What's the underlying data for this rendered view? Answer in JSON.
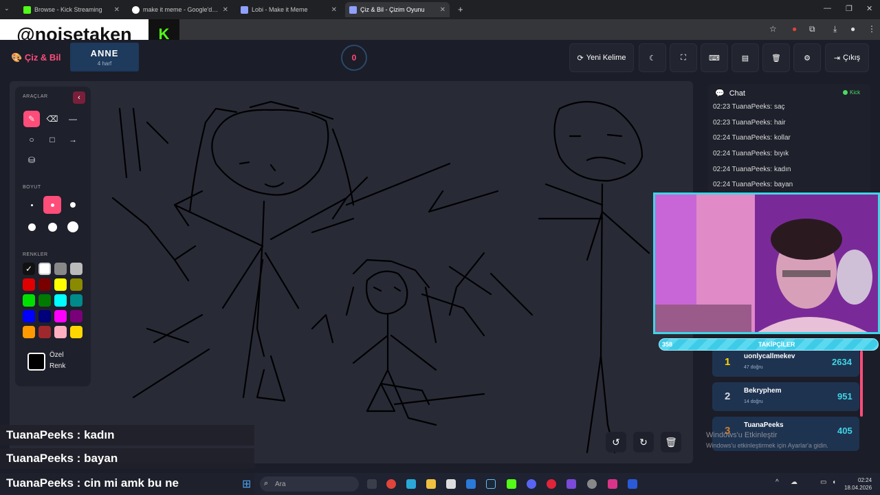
{
  "browser": {
    "tabs": [
      {
        "label": "Browse - Kick Streaming",
        "favicon_color": "#53fc18"
      },
      {
        "label": "make it meme - Google'da Ara",
        "favicon_color": "#ffffff"
      },
      {
        "label": "Lobi - Make it Meme",
        "favicon_color": "#8fa0ff"
      },
      {
        "label": "Çiz & Bil - Çizim Oyunu",
        "favicon_color": "#8fa0ff"
      }
    ]
  },
  "overlay": {
    "handle": "@noisetaken",
    "kick_logo": "K",
    "chat": [
      {
        "text": "TuanaPeeks : kadın"
      },
      {
        "text": "TuanaPeeks : bayan"
      },
      {
        "text": "TuanaPeeks : cin mi amk bu ne"
      }
    ]
  },
  "header": {
    "brand": "Çiz & Bil",
    "word": "ANNE",
    "word_letters": "4 harf",
    "timer": "0",
    "new_word_label": "Yeni Kelime",
    "exit_label": "Çıkış"
  },
  "tools": {
    "section_tools": "ARAÇLAR",
    "section_size": "BOYUT",
    "section_colors": "RENKLER",
    "custom_line1": "Özel",
    "custom_line2": "Renk",
    "colors": [
      "#111111",
      "#ffffff",
      "#888888",
      "#bbbbbb",
      "#e00000",
      "#7a0000",
      "#ffff00",
      "#8a8a00",
      "#00e000",
      "#007a00",
      "#00ffff",
      "#008a8a",
      "#0000ff",
      "#00007a",
      "#ff00ff",
      "#7a007a",
      "#ff9900",
      "#a0282c",
      "#ffb0c0",
      "#ffd700"
    ]
  },
  "chat": {
    "title": "Chat",
    "badge": "Kick",
    "messages": [
      {
        "text": "02:23 TuanaPeeks: saç"
      },
      {
        "text": "02:23 TuanaPeeks: hair"
      },
      {
        "text": "02:24 TuanaPeeks: kollar"
      },
      {
        "text": "02:24 TuanaPeeks: bıyık"
      },
      {
        "text": "02:24 TuanaPeeks: kadın"
      },
      {
        "text": "02:24 TuanaPeeks: bayan"
      }
    ]
  },
  "followers": {
    "count": "358",
    "label": "TAKİPÇİLER"
  },
  "leaderboard": [
    {
      "rank": "1",
      "name": "uonlycallmekev",
      "correct": "47 doğru",
      "score": "2634",
      "rank_color": "#ffd700"
    },
    {
      "rank": "2",
      "name": "Bekryphem",
      "correct": "14 doğru",
      "score": "951",
      "rank_color": "#d8d8e0"
    },
    {
      "rank": "3",
      "name": "TuanaPeeks",
      "correct": "",
      "score": "405",
      "rank_color": "#cd7f32"
    }
  ],
  "windows": {
    "activate_title": "Windows'u Etkinleştir",
    "activate_sub": "Windows'u etkinleştirmek için Ayarlar'a gidin.",
    "search_placeholder": "Ara",
    "time": "02:24",
    "date": "18.04.2026"
  }
}
